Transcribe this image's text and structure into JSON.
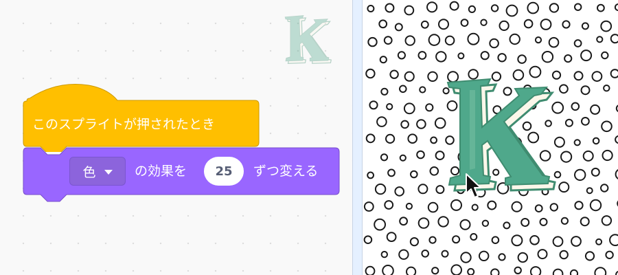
{
  "code_area": {
    "sprite_thumbnail_icon": "letter-k-sprite-icon",
    "hat_block": {
      "label": "このスプライトが押されたとき",
      "color": "#ffbf00"
    },
    "looks_block": {
      "effect_dropdown_value": "色",
      "label_before": "の効果を",
      "amount": "25",
      "label_after": "ずつ変える",
      "color": "#9966ff"
    }
  },
  "stage": {
    "backdrop": "polka-dots",
    "sprite_icon": "letter-k-sprite",
    "sprite_color": "#4fa88b",
    "cursor_icon": "mouse-pointer-icon"
  }
}
